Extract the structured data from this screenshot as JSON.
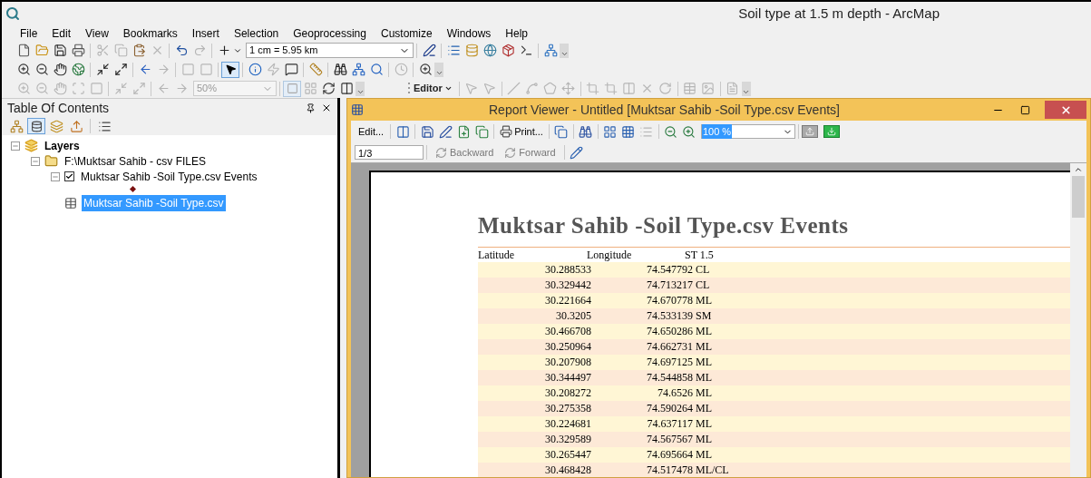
{
  "window": {
    "title": "Soil type at 1.5 m depth - ArcMap"
  },
  "menu": [
    "File",
    "Edit",
    "View",
    "Bookmarks",
    "Insert",
    "Selection",
    "Geoprocessing",
    "Customize",
    "Windows",
    "Help"
  ],
  "toolbar": {
    "scale": "1 cm = 5.95 km",
    "zoom": "50%",
    "editor": "Editor"
  },
  "toc": {
    "title": "Table Of Contents",
    "tree": [
      {
        "label": "Layers",
        "kind": "layers",
        "expanded": true,
        "children": [
          {
            "label": "F:\\Muktsar Sahib - csv FILES",
            "kind": "folder",
            "expanded": true,
            "children": [
              {
                "label": "Muktsar Sahib -Soil Type.csv Events",
                "kind": "layer",
                "expanded": true,
                "checked": true,
                "selected": false
              },
              {
                "label": "Muktsar Sahib -Soil Type.csv",
                "kind": "table",
                "selected": true
              }
            ]
          }
        ]
      }
    ]
  },
  "report_viewer": {
    "title": "Report Viewer - Untitled [Muktsar Sahib -Soil Type.csv Events]",
    "edit": "Edit...",
    "print": "Print...",
    "zoom": "100 %",
    "page": "1/3",
    "backward": "Backward",
    "forward": "Forward",
    "report": {
      "title": "Muktsar Sahib -Soil Type.csv Events",
      "columns": [
        "Latitude",
        "Longitude",
        "ST 1.5"
      ],
      "rows": [
        [
          "30.288533",
          "74.547792",
          "CL"
        ],
        [
          "30.329442",
          "74.713217",
          "CL"
        ],
        [
          "30.221664",
          "74.670778",
          "ML"
        ],
        [
          "30.3205",
          "74.533139",
          "SM"
        ],
        [
          "30.466708",
          "74.650286",
          "ML"
        ],
        [
          "30.250964",
          "74.662731",
          "ML"
        ],
        [
          "30.207908",
          "74.697125",
          "ML"
        ],
        [
          "30.344497",
          "74.544858",
          "ML"
        ],
        [
          "30.208272",
          "74.6526",
          "ML"
        ],
        [
          "30.275358",
          "74.590264",
          "ML"
        ],
        [
          "30.224681",
          "74.637117",
          "ML"
        ],
        [
          "30.329589",
          "74.567567",
          "ML"
        ],
        [
          "30.265447",
          "74.695664",
          "ML"
        ],
        [
          "30.468428",
          "74.517478",
          "ML/CL"
        ]
      ]
    }
  }
}
